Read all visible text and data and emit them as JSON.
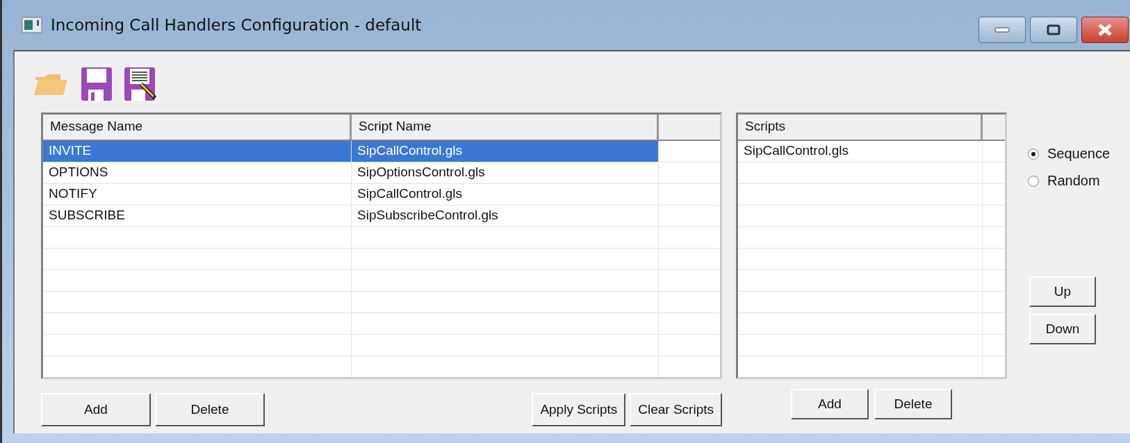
{
  "window": {
    "title": "Incoming Call Handlers Configuration - default"
  },
  "handlers_table": {
    "columns": [
      "Message Name",
      "Script Name"
    ],
    "rows": [
      {
        "message": "INVITE",
        "script": "SipCallControl.gls",
        "selected": true
      },
      {
        "message": "OPTIONS",
        "script": "SipOptionsControl.gls",
        "selected": false
      },
      {
        "message": "NOTIFY",
        "script": "SipCallControl.gls",
        "selected": false
      },
      {
        "message": "SUBSCRIBE",
        "script": "SipSubscribeControl.gls",
        "selected": false
      }
    ]
  },
  "scripts_table": {
    "columns": [
      "Scripts"
    ],
    "rows": [
      {
        "name": "SipCallControl.gls",
        "selected": false
      }
    ]
  },
  "order": [
    {
      "label": "Sequence",
      "selected": true
    },
    {
      "label": "Random",
      "selected": false
    }
  ],
  "move_buttons": [
    "Up",
    "Down"
  ],
  "handlers_buttons_left": [
    "Add",
    "Delete"
  ],
  "handlers_buttons_right": [
    "Apply Scripts",
    "Clear Scripts"
  ],
  "scripts_buttons": [
    "Add",
    "Delete"
  ]
}
